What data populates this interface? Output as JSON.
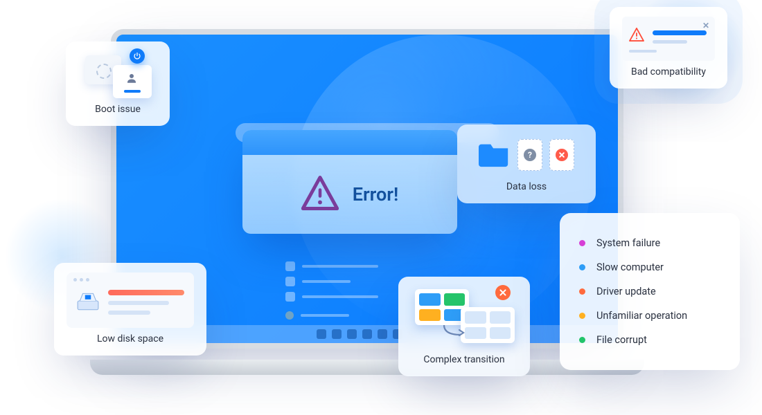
{
  "cards": {
    "boot": {
      "label": "Boot issue"
    },
    "compat": {
      "label": "Bad compatibility"
    },
    "error": {
      "label": "Error!"
    },
    "data_loss": {
      "label": "Data loss"
    },
    "low_disk": {
      "label": "Low disk space"
    },
    "transition": {
      "label": "Complex transition"
    }
  },
  "legend": [
    {
      "color": "#d63fd6",
      "label": "System failure"
    },
    {
      "color": "#2e9df7",
      "label": "Slow computer"
    },
    {
      "color": "#ff6a3d",
      "label": "Driver update"
    },
    {
      "color": "#ffb020",
      "label": "Unfamiliar operation"
    },
    {
      "color": "#22c46a",
      "label": "File corrupt"
    }
  ]
}
